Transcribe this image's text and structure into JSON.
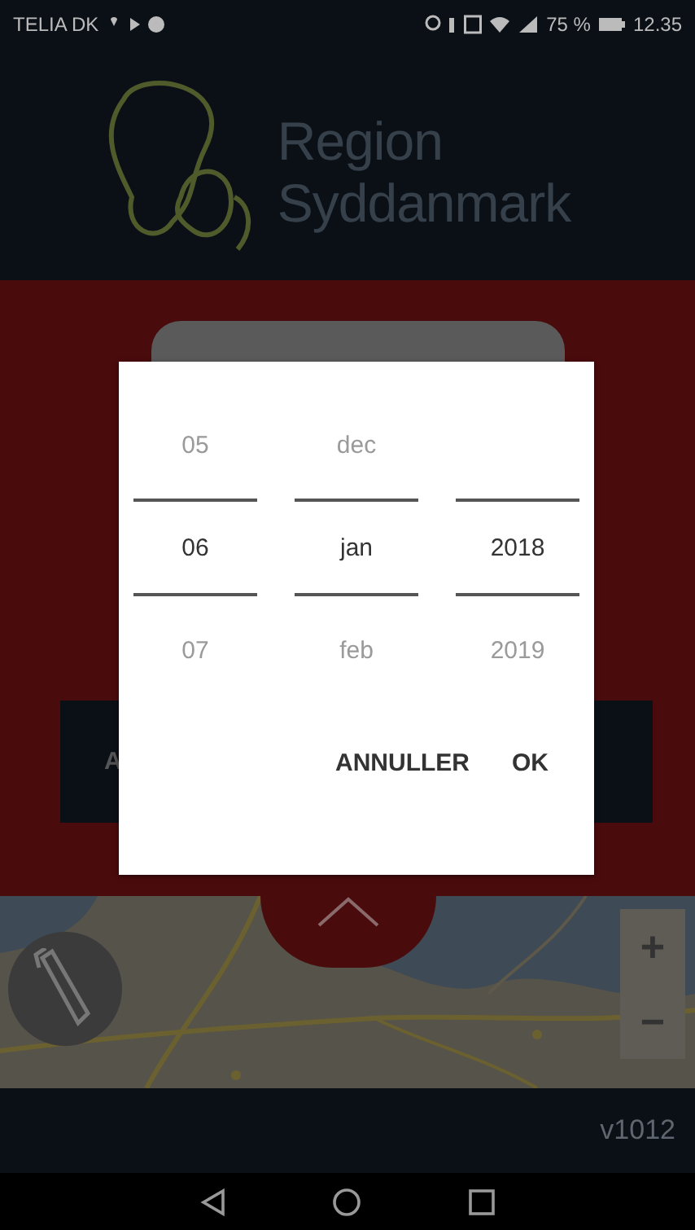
{
  "status_bar": {
    "carrier": "TELIA DK",
    "battery": "75 %",
    "time": "12.35"
  },
  "header": {
    "logo_lines": [
      "Region",
      "Syddanmark"
    ]
  },
  "background_button": {
    "label": "A"
  },
  "date_picker": {
    "columns": [
      {
        "above": "05",
        "value": "06",
        "below": "07"
      },
      {
        "above": "dec",
        "value": "jan",
        "below": "feb"
      },
      {
        "value": "2018",
        "below": "2019"
      }
    ],
    "buttons": [
      "ANNULLER",
      "OK"
    ]
  },
  "map": {
    "kind": "picture",
    "zoom_in": "+",
    "zoom_out": "−"
  },
  "footer": {
    "version": "v1012"
  }
}
